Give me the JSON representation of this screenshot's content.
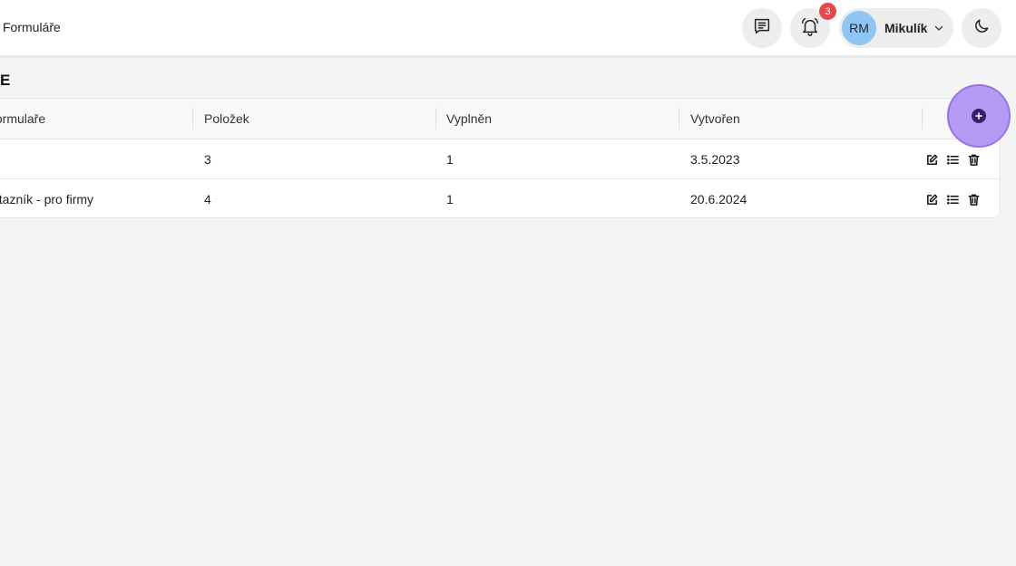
{
  "header": {
    "breadcrumb": "Formuláře",
    "notifications_count": "3",
    "user": {
      "initials": "RM",
      "name": "Mikulík"
    }
  },
  "page": {
    "title": "E"
  },
  "table": {
    "columns": [
      "formulaře",
      "Položek",
      "Vyplněn",
      "Vytvořen"
    ],
    "rows": [
      {
        "name": "",
        "items": "3",
        "filled": "1",
        "created": "3.5.2023"
      },
      {
        "name": "otazník - pro firmy",
        "items": "4",
        "filled": "1",
        "created": "20.6.2024"
      }
    ]
  },
  "icons": {
    "messages": "message-list-icon",
    "notifications": "bell-icon",
    "theme": "moon-icon",
    "add": "plus-circle-icon",
    "edit": "edit-icon",
    "list": "list-icon",
    "delete": "trash-icon"
  },
  "colors": {
    "accent": "#9c72e8",
    "badge": "#e5484d",
    "avatar": "#8ec5f5"
  }
}
